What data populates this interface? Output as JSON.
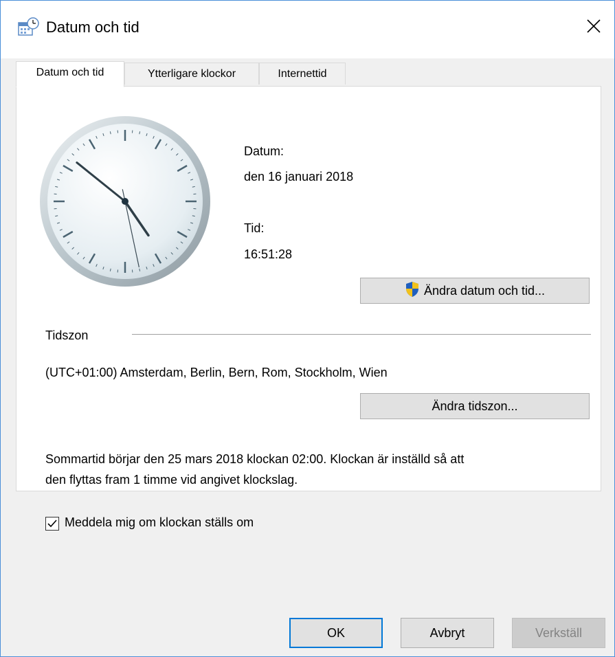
{
  "window": {
    "title": "Datum och tid"
  },
  "tabs": [
    {
      "label": "Datum och tid",
      "active": true
    },
    {
      "label": "Ytterligare klockor",
      "active": false
    },
    {
      "label": "Internettid",
      "active": false
    }
  ],
  "date": {
    "label": "Datum:",
    "value": "den 16 januari 2018"
  },
  "time": {
    "label": "Tid:",
    "value": "16:51:28"
  },
  "buttons": {
    "change_datetime": "Ändra datum och tid...",
    "change_timezone": "Ändra tidszon...",
    "ok": "OK",
    "cancel": "Avbryt",
    "apply": "Verkställ"
  },
  "timezone": {
    "heading": "Tidszon",
    "value": "(UTC+01:00) Amsterdam, Berlin, Bern, Rom, Stockholm, Wien"
  },
  "dst": {
    "line1": "Sommartid börjar den 25 mars 2018 klockan 02:00. Klockan är inställd så att",
    "line2": "den flyttas fram 1 timme vid angivet klockslag."
  },
  "notify": {
    "label": "Meddela mig om klockan ställs om",
    "checked": true
  },
  "colors": {
    "accent": "#0078d7",
    "window_border": "#4a8fd9"
  },
  "icons": {
    "title": "date-time-icon",
    "close": "close-icon",
    "shield": "uac-shield-icon",
    "check": "checkmark-icon"
  }
}
